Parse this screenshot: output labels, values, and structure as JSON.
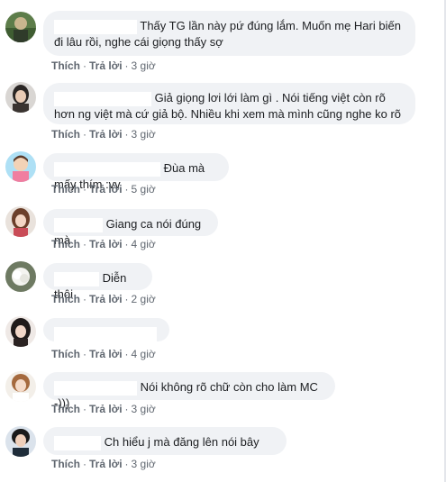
{
  "actions": {
    "like": "Thích",
    "reply": "Trả lời"
  },
  "comments": [
    {
      "text_line1": "Thấy TG lần này pứ đúng lắm. Muốn mẹ Hari biến",
      "text_line2": "đi lâu rồi, nghe cái giọng thấy sợ",
      "time": "3 giờ"
    },
    {
      "text_line1": "Giả giọng lơi lới làm gì . Nói tiếng việt còn rõ",
      "text_line2": "hơn ng việt mà cứ giả bộ. Nhiều khi xem mà mình cũng nghe ko rõ",
      "time": "3 giờ"
    },
    {
      "text": "Đùa mà mấy thím :vv",
      "time": "5 giờ"
    },
    {
      "text": "Giang ca nói đúng mà",
      "time": "4 giờ"
    },
    {
      "text": "Diễn thôi",
      "time": "2 giờ"
    },
    {
      "text": "",
      "time": "4 giờ"
    },
    {
      "text": "Nói không rõ chữ còn cho làm MC -)))",
      "time": "3 giờ"
    },
    {
      "text": "Ch hiểu j mà đăng lên nói bây",
      "time": "3 giờ"
    }
  ]
}
